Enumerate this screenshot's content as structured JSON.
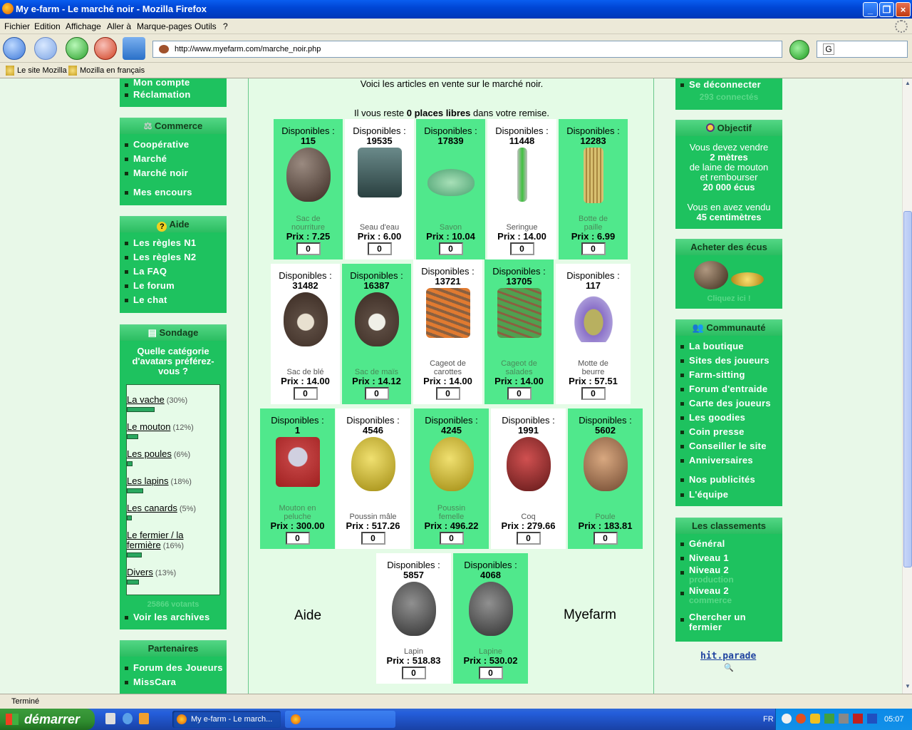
{
  "window": {
    "title": "My e-farm - Le marché noir - Mozilla Firefox"
  },
  "menu": [
    "Fichier",
    "Edition",
    "Affichage",
    "Aller à",
    "Marque-pages",
    "Outils",
    "?"
  ],
  "url": "http://www.myefarm.com/marche_noir.php",
  "search_value": "G",
  "bookmarks": [
    "Le site Mozilla",
    "Mozilla en français"
  ],
  "left": {
    "account": [
      "Mon compte",
      "Réclamation"
    ],
    "commerce": {
      "title": "Commerce",
      "items": [
        "Coopérative",
        "Marché",
        "Marché noir",
        "Mes encours"
      ]
    },
    "aide": {
      "title": "Aide",
      "items": [
        "Les règles N1",
        "Les règles N2",
        "La FAQ",
        "Le forum",
        "Le chat"
      ]
    },
    "sondage": {
      "title": "Sondage",
      "question": "Quelle catégorie d'avatars préférez-vous ?",
      "options": [
        {
          "label": "La vache",
          "pct": "(30%)",
          "value": 30
        },
        {
          "label": "Le mouton",
          "pct": "(12%)",
          "value": 12
        },
        {
          "label": "Les poules",
          "pct": "(6%)",
          "value": 6
        },
        {
          "label": "Les lapins",
          "pct": "(18%)",
          "value": 18
        },
        {
          "label": "Les canards",
          "pct": "(5%)",
          "value": 5
        },
        {
          "label": "Le fermier / la fermière",
          "pct": "(16%)",
          "value": 16
        },
        {
          "label": "Divers",
          "pct": "(13%)",
          "value": 13
        }
      ],
      "votes": "25866 votants",
      "archives": "Voir les archives"
    },
    "partenaires": {
      "title": "Partenaires",
      "items": [
        "Forum des Joueurs",
        "MissCara"
      ]
    }
  },
  "main": {
    "intro": "Voici les articles en vente sur le marché noir.",
    "remise_pre": "Il vous reste",
    "remise_bold": "0 places libres",
    "remise_post": "dans votre remise.",
    "dispo_label": "Disponibles :",
    "prix_label": "Prix :",
    "items": [
      {
        "dispo": "115",
        "name": "Sac de nourriture",
        "price": "7.25",
        "qty": "0",
        "icon": "sack-icon"
      },
      {
        "dispo": "19535",
        "name": "Seau d'eau",
        "price": "6.00",
        "qty": "0",
        "icon": "bucket-icon"
      },
      {
        "dispo": "17839",
        "name": "Savon",
        "price": "10.04",
        "qty": "0",
        "icon": "soap-icon"
      },
      {
        "dispo": "11448",
        "name": "Seringue",
        "price": "14.00",
        "qty": "0",
        "icon": "syringe-icon"
      },
      {
        "dispo": "12283",
        "name": "Botte de paille",
        "price": "6.99",
        "qty": "0",
        "icon": "straw-icon"
      },
      {
        "dispo": "31482",
        "name": "Sac de blé",
        "price": "14.00",
        "qty": "0",
        "icon": "wheat-sack-icon"
      },
      {
        "dispo": "16387",
        "name": "Sac de maïs",
        "price": "14.12",
        "qty": "0",
        "icon": "corn-sack-icon"
      },
      {
        "dispo": "13721",
        "name": "Cageot de carottes",
        "price": "14.00",
        "qty": "0",
        "icon": "carrot-crate-icon"
      },
      {
        "dispo": "13705",
        "name": "Cageot de salades",
        "price": "14.00",
        "qty": "0",
        "icon": "salad-crate-icon"
      },
      {
        "dispo": "117",
        "name": "Motte de beurre",
        "price": "57.51",
        "qty": "0",
        "icon": "butter-icon"
      },
      {
        "dispo": "1",
        "name": "Mouton en peluche",
        "price": "300.00",
        "qty": "0",
        "icon": "plush-sheep-icon"
      },
      {
        "dispo": "4546",
        "name": "Poussin mâle",
        "price": "517.26",
        "qty": "0",
        "icon": "chick-icon"
      },
      {
        "dispo": "4245",
        "name": "Poussin femelle",
        "price": "496.22",
        "qty": "0",
        "icon": "chick-icon"
      },
      {
        "dispo": "1991",
        "name": "Coq",
        "price": "279.66",
        "qty": "0",
        "icon": "rooster-icon"
      },
      {
        "dispo": "5602",
        "name": "Poule",
        "price": "183.81",
        "qty": "0",
        "icon": "hen-icon"
      },
      {
        "dispo": "5857",
        "name": "Lapin",
        "price": "518.83",
        "qty": "0",
        "icon": "rabbit-icon"
      },
      {
        "dispo": "4068",
        "name": "Lapine",
        "price": "530.02",
        "qty": "0",
        "icon": "rabbit-icon"
      }
    ],
    "aide_link": "Aide",
    "brand": "Myefarm"
  },
  "right": {
    "logout": "Se déconnecter",
    "connected": "293 connectés",
    "objectif": {
      "title": "Objectif",
      "line1": "Vous devez vendre",
      "qty": "2 mètres",
      "line2": "de laine de mouton",
      "line3": "et rembourser",
      "amount": "20 000 écus",
      "line4": "Vous en avez vendu",
      "sold": "45 centimètres"
    },
    "ecus": {
      "title": "Acheter des écus",
      "cta": "Cliquez ici !"
    },
    "communaute": {
      "title": "Communauté",
      "items": [
        "La boutique",
        "Sites des joueurs",
        "Farm-sitting",
        "Forum d'entraide",
        "Carte des joueurs",
        "Les goodies",
        "Coin presse",
        "Conseiller le site",
        "Anniversaires",
        "Nos publicités",
        "L'équipe"
      ]
    },
    "classements": {
      "title": "Les classements",
      "items": [
        "Général",
        "Niveau 1",
        "Niveau 2",
        "Niveau 2",
        "Chercher un fermier"
      ],
      "subs": [
        "production",
        "commerce"
      ]
    },
    "hitparade": "hit.parade"
  },
  "status": "Terminé",
  "taskbar": {
    "start": "démarrer",
    "tasks": [
      "My e-farm - Le march..."
    ],
    "lang": "FR",
    "clock": "05:07"
  }
}
